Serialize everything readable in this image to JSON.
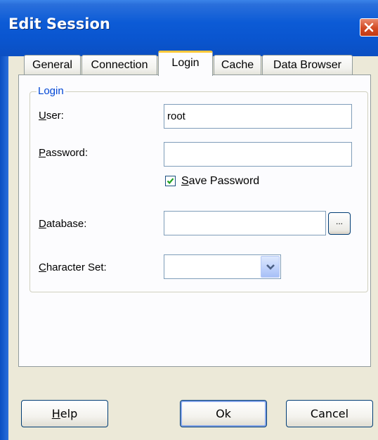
{
  "window": {
    "title": "Edit Session"
  },
  "tabs": [
    {
      "label": "General"
    },
    {
      "label": "Connection"
    },
    {
      "label": "Login",
      "active": true
    },
    {
      "label": "Cache"
    },
    {
      "label": "Data Browser"
    }
  ],
  "login_group": {
    "title": "Login",
    "user": {
      "label_mnemonic": "U",
      "label_rest": "ser:",
      "value": "root"
    },
    "password": {
      "label_mnemonic": "P",
      "label_rest": "assword:",
      "value": ""
    },
    "save_password": {
      "label_mnemonic": "S",
      "label_rest": "ave Password",
      "checked": true
    },
    "database": {
      "label_mnemonic": "D",
      "label_rest": "atabase:",
      "value": "",
      "browse_label": "..."
    },
    "charset": {
      "label_mnemonic": "C",
      "label_rest": "haracter Set:",
      "selected": ""
    }
  },
  "buttons": {
    "help": {
      "mnemonic": "H",
      "rest": "elp"
    },
    "ok": {
      "label": "Ok"
    },
    "cancel": {
      "label": "Cancel"
    }
  },
  "icons": {
    "close": "close-icon",
    "check": "check-icon",
    "dropdown": "chevron-down-icon"
  },
  "colors": {
    "titlebar": "#0a55cf",
    "accent_tab": "#ffc83c",
    "group_title": "#0046d5",
    "close_button": "#d24a24"
  }
}
